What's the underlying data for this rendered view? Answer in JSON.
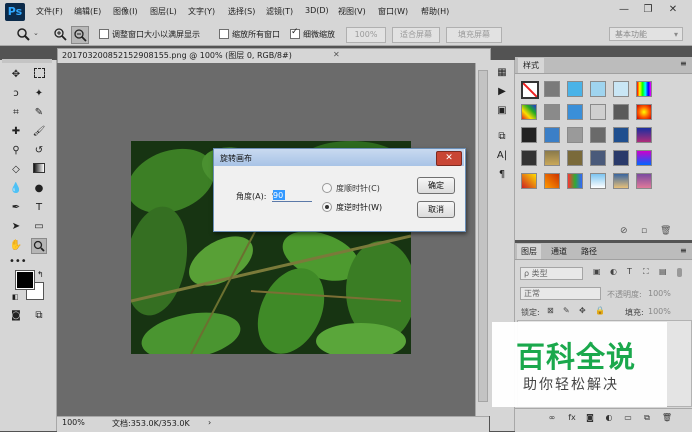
{
  "app": {
    "logo": "Ps"
  },
  "menu": [
    "文件(F)",
    "编辑(E)",
    "图像(I)",
    "图层(L)",
    "文字(Y)",
    "选择(S)",
    "滤镜(T)",
    "3D(D)",
    "视图(V)",
    "窗口(W)",
    "帮助(H)"
  ],
  "window_controls": {
    "minimize": "—",
    "restore": "❐",
    "close": "✕"
  },
  "options": {
    "resize_windows_label": "调整窗口大小以满屏显示",
    "zoom_all_label": "缩放所有窗口",
    "scrubby_zoom_label": "细微缩放",
    "zoom_value": "100%",
    "fit_screen": "适合屏幕",
    "fill_screen": "填充屏幕",
    "workspace": "基本功能",
    "resize_windows_checked": false,
    "zoom_all_checked": false,
    "scrubby_zoom_checked": true
  },
  "document": {
    "tab_title": "20170320085215290815​5.png @ 100% (图层 0, RGB/8#)",
    "tab_close": "✕",
    "zoom": "100%",
    "doc_info": "文档:353.0K/353.0K"
  },
  "dialog": {
    "title": "旋转画布",
    "angle_label": "角度(A):",
    "angle_value": "90",
    "cw_label": "度顺时针(C)",
    "ccw_label": "度逆时针(W)",
    "selected": "ccw",
    "ok": "确定",
    "cancel": "取消",
    "close": "✕"
  },
  "styles_panel": {
    "tab": "样式"
  },
  "layers_panel": {
    "tabs": [
      "图层",
      "通道",
      "路径"
    ],
    "filter_label": "ρ 类型",
    "blend_mode": "正常",
    "opacity_label": "不透明度:",
    "opacity_value": "100%",
    "lock_label": "锁定:",
    "fill_label": "填充:",
    "fill_value": "100%"
  },
  "watermark": {
    "title": "百科全说",
    "subtitle": "助你轻松解决"
  },
  "colors": {
    "accent": "#31a8ff",
    "watermark_green": "#1aa84c",
    "ui_gray": "#d6d6d6",
    "canvas_bg": "#6b6b6b"
  }
}
